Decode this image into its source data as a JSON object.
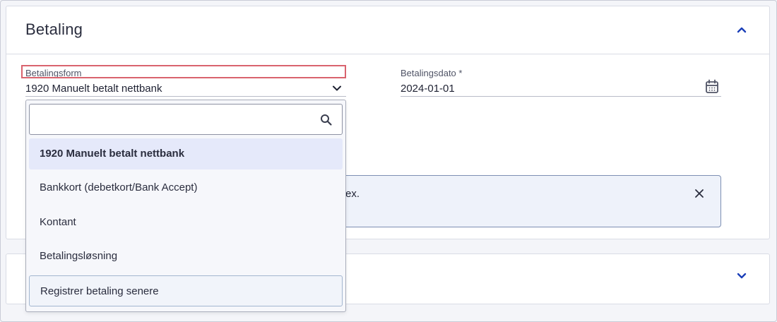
{
  "section": {
    "title": "Betaling",
    "payment_method": {
      "label": "Betalingsform",
      "value": "1920 Manuelt betalt nettbank"
    },
    "payment_date": {
      "label": "Betalingsdato *",
      "value": "2024-01-01"
    },
    "info": {
      "text_visible": "ex."
    }
  },
  "dropdown": {
    "search_placeholder": "",
    "options": [
      {
        "label": "1920 Manuelt betalt nettbank"
      },
      {
        "label": "Bankkort (debetkort/Bank Accept)"
      },
      {
        "label": "Kontant"
      },
      {
        "label": "Betalingsløsning"
      },
      {
        "label": "Registrer betaling senere"
      }
    ]
  },
  "colors": {
    "accent": "#1a3fb8",
    "highlight": "#d9636e",
    "selected_option_bg": "#e5e9fa"
  },
  "icons": [
    "chevron-up-icon",
    "chevron-down-icon",
    "calendar-icon",
    "search-icon",
    "close-icon"
  ]
}
